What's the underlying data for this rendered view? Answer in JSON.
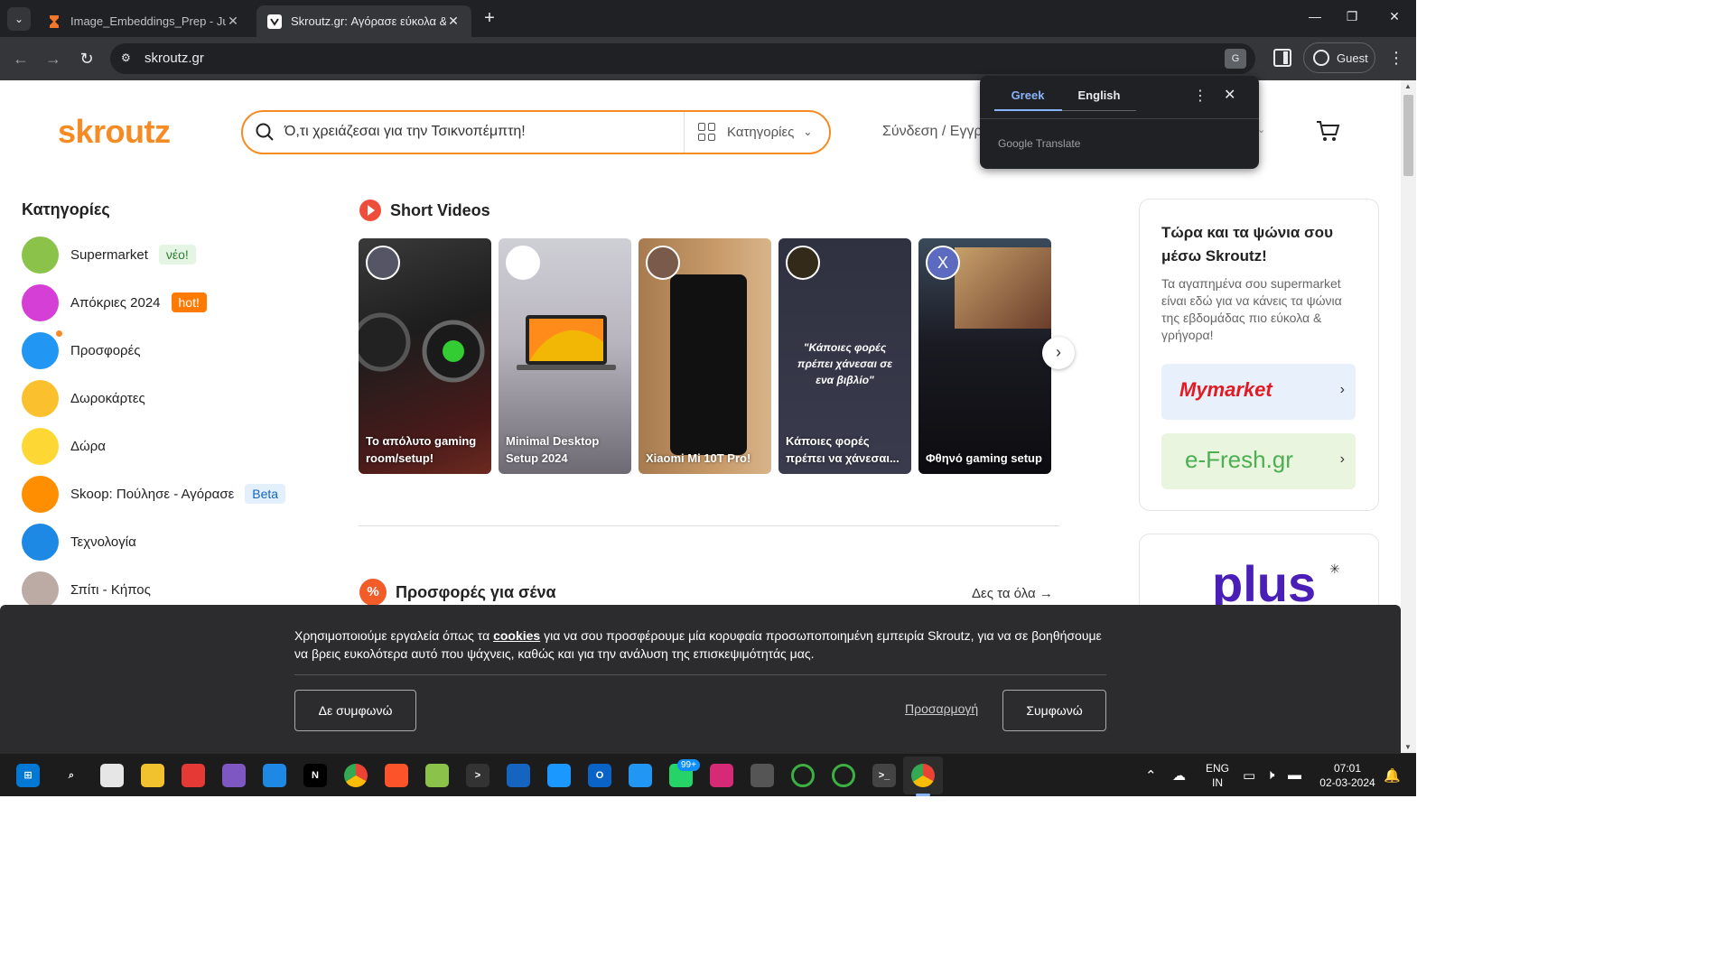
{
  "browser": {
    "tabs": [
      {
        "title": "Image_Embeddings_Prep - Jupyter",
        "active": false
      },
      {
        "title": "Skroutz.gr: Αγόρασε εύκολα & γρήγορα",
        "active": true
      }
    ],
    "new_tab": "+",
    "url": "skroutz.gr",
    "profile_label": "Guest"
  },
  "translate_popup": {
    "languages": [
      "Greek",
      "English"
    ],
    "active_language": "Greek",
    "powered_by": "Google Translate"
  },
  "header": {
    "logo": "skroutz",
    "search_placeholder": "Ό,τι χρειάζεσαι για την Τσικνοπέμπτη!",
    "categories_label": "Κατηγορίες",
    "login_label": "Σύνδεση / Εγγραφή"
  },
  "sidebar": {
    "title": "Κατηγορίες",
    "items": [
      {
        "label": "Supermarket",
        "badge": "νέο!",
        "color": "#8bc34a"
      },
      {
        "label": "Απόκριες 2024",
        "badge": "hot!",
        "color": "#d63fd6"
      },
      {
        "label": "Προσφορές",
        "badge": "",
        "color": "#2196f3"
      },
      {
        "label": "Δωροκάρτες",
        "badge": "",
        "color": "#fbc02d"
      },
      {
        "label": "Δώρα",
        "badge": "",
        "color": "#fdd835"
      },
      {
        "label": "Skoop: Πούλησε - Αγόρασε",
        "badge": "Beta",
        "color": "#ff8f00"
      },
      {
        "label": "Τεχνολογία",
        "badge": "",
        "color": "#1e88e5"
      },
      {
        "label": "Σπίτι - Κήπος",
        "badge": "",
        "color": "#bcaaa4"
      }
    ]
  },
  "short_videos": {
    "title": "Short Videos",
    "videos": [
      {
        "caption": "Το απόλυτο gaming room/setup!",
        "quote": "",
        "avatar_letter": ""
      },
      {
        "caption": "Minimal Desktop Setup 2024",
        "quote": "",
        "avatar_letter": ""
      },
      {
        "caption": "Xiaomi Mi 10T Pro!",
        "quote": "",
        "avatar_letter": ""
      },
      {
        "caption": "Κάποιες φορές πρέπει να χάνεσαι...",
        "quote": "\"Κάποιες φορές πρέπει χάνεσαι σε ενα βιβλίο\"",
        "avatar_letter": ""
      },
      {
        "caption": "Φθηνό gaming setup",
        "quote": "",
        "avatar_letter": "X"
      }
    ]
  },
  "offers": {
    "title": "Προσφορές για σένα",
    "see_all": "Δες τα όλα →",
    "icon_text": "%"
  },
  "promo": {
    "title": "Τώρα και τα ψώνια σου μέσω Skroutz!",
    "text": "Τα αγαπημένα σου supermarket είναι εδώ για να κάνεις τα ψώνια της εβδομάδας πιο εύκολα & γρήγορα!",
    "stores": [
      "Mymarket",
      "e-Fresh.gr"
    ],
    "plus_logo": "plus"
  },
  "cookie": {
    "text_before": "Χρησιμοποιούμε εργαλεία όπως τα ",
    "link": "cookies",
    "text_after": " για να σου προσφέρουμε μία κορυφαία προσωποποιημένη εμπειρία Skroutz, για να σε βοηθήσουμε να βρεις ευκολότερα αυτό που ψάχνεις, καθώς και για την ανάλυση της επισκεψιμότητάς μας.",
    "disagree": "Δε συμφωνώ",
    "customize": "Προσαρμογή",
    "agree": "Συμφωνώ"
  },
  "taskbar": {
    "badge": "99+",
    "lang_top": "ENG",
    "lang_bottom": "IN",
    "time": "07:01",
    "date": "02-03-2024"
  }
}
